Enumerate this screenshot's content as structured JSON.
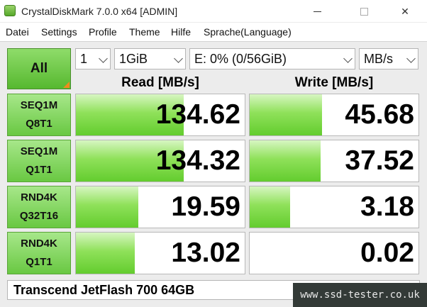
{
  "window": {
    "title": "CrystalDiskMark 7.0.0 x64 [ADMIN]",
    "controls": {
      "minimize_icon": "minimize-icon",
      "maximize_icon": "maximize-icon",
      "close_label": "✕"
    }
  },
  "menu": [
    "Datei",
    "Settings",
    "Profile",
    "Theme",
    "Hilfe",
    "Sprache(Language)"
  ],
  "toolbar": {
    "all_label": "All",
    "count": "1",
    "size": "1GiB",
    "drive": "E: 0% (0/56GiB)",
    "unit": "MB/s"
  },
  "headers": {
    "read": "Read [MB/s]",
    "write": "Write [MB/s]"
  },
  "tests": [
    {
      "line1": "SEQ1M",
      "line2": "Q8T1",
      "read": "134.62",
      "write": "45.68",
      "read_fill": 0.64,
      "write_fill": 0.43
    },
    {
      "line1": "SEQ1M",
      "line2": "Q1T1",
      "read": "134.32",
      "write": "37.52",
      "read_fill": 0.64,
      "write_fill": 0.42
    },
    {
      "line1": "RND4K",
      "line2": "Q32T16",
      "read": "19.59",
      "write": "3.18",
      "read_fill": 0.37,
      "write_fill": 0.24
    },
    {
      "line1": "RND4K",
      "line2": "Q1T1",
      "read": "13.02",
      "write": "0.02",
      "read_fill": 0.35,
      "write_fill": 0.0
    }
  ],
  "drive_label": "Transcend JetFlash 700 64GB",
  "watermark": "www.ssd-tester.co.uk",
  "colors": {
    "accent_green": "#63cc2e",
    "corner_orange": "#f08a1c"
  }
}
